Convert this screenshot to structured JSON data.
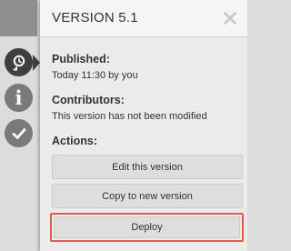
{
  "panel": {
    "title": "VERSION 5.1",
    "close_icon": "close-icon"
  },
  "published": {
    "label": "Published:",
    "value": "Today 11:30 by you"
  },
  "contributors": {
    "label": "Contributors:",
    "value": "This version has not been modified"
  },
  "actions": {
    "label": "Actions:",
    "edit_label": "Edit this version",
    "copy_label": "Copy to new version",
    "deploy_label": "Deploy"
  },
  "sidebar": {
    "icons": [
      "history-icon",
      "info-icon",
      "check-icon"
    ]
  },
  "colors": {
    "highlight": "#e05a4e",
    "panel_bg": "#ebebeb",
    "active_icon": "#3f3f3f",
    "inactive_icon": "#7a7a7a"
  }
}
